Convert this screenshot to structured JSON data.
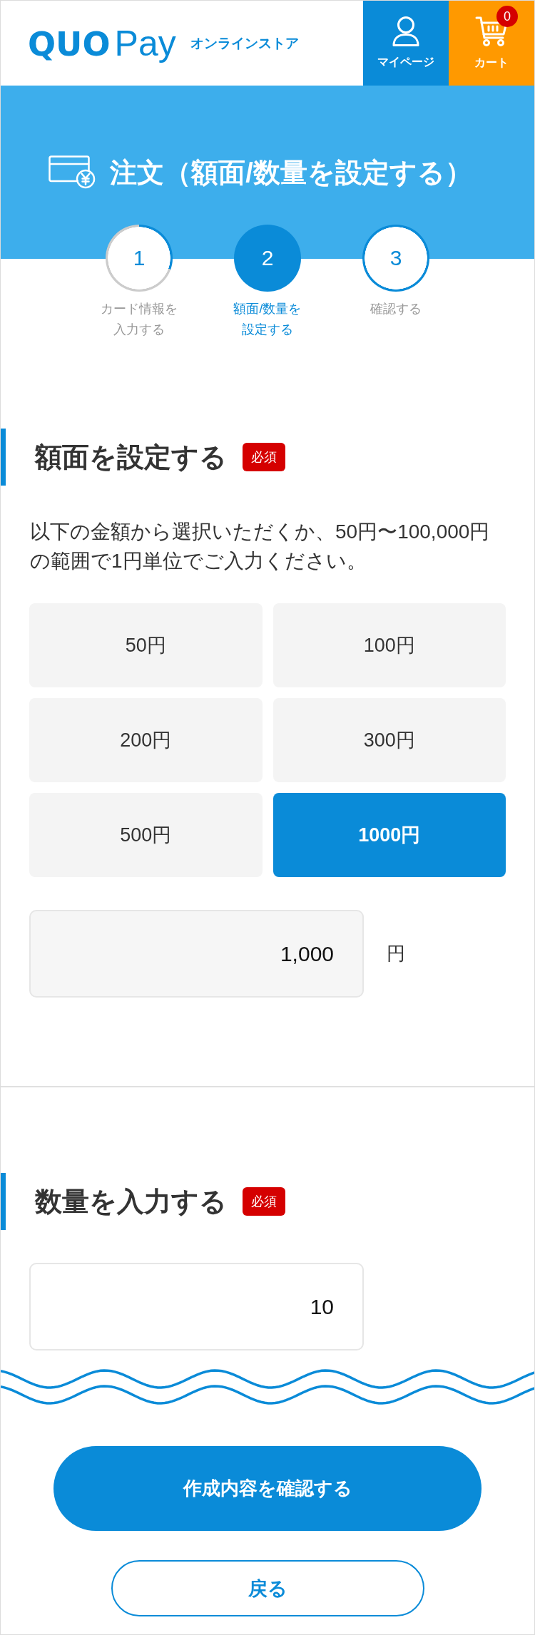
{
  "header": {
    "logo": "**QUO**Pay",
    "store_label": "オンラインストア",
    "mypage_button": "マイページ",
    "cart_button": "カート",
    "cart_count": "0"
  },
  "banner": {
    "title": "注文（額面/数量を設定する）"
  },
  "steps": [
    {
      "number": "1",
      "label_lines": [
        "カード情報を",
        "入力する"
      ],
      "selected": false,
      "completed": true
    },
    {
      "number": "2",
      "label_lines": [
        "額面/数量を",
        "設定する"
      ],
      "selected": true,
      "completed": false
    },
    {
      "number": "3",
      "label_lines": [
        "確認する"
      ],
      "selected": false,
      "completed": false
    }
  ],
  "face_value_section": {
    "heading": "額面を設定する",
    "badge": "必須",
    "description_lines": [
      "以下の金額から選択いただくか、50円〜100,000円",
      "の範囲で1円単位でご入力ください。"
    ],
    "options": [
      {
        "label": "50円",
        "selected": false
      },
      {
        "label": "100円",
        "selected": false
      },
      {
        "label": "200円",
        "selected": false
      },
      {
        "label": "300円",
        "selected": false
      },
      {
        "label": "500円",
        "selected": false
      },
      {
        "label": "1000円",
        "selected": true
      }
    ],
    "amount_field": {
      "value": "1,000",
      "unit": "円"
    }
  },
  "quantity_section": {
    "heading": "数量を入力する",
    "badge": "必須",
    "quantity_field": {
      "value": "10"
    }
  },
  "actions": {
    "confirm_button": "作成内容を確認する",
    "back_button": "戻る"
  }
}
